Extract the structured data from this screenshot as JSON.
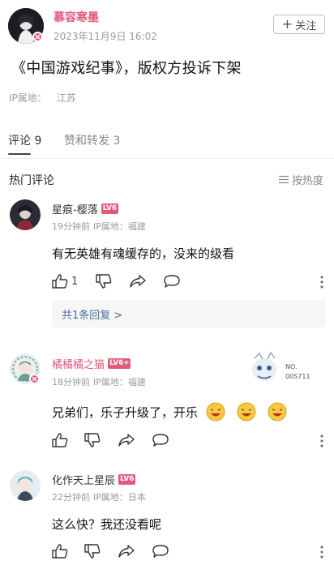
{
  "post": {
    "author": "慕容寒墨",
    "time": "2023年11月9日 16:02",
    "follow_label": "关注",
    "title": "《中国游戏纪事》，版权方投诉下架",
    "ip_label": "IP属地：",
    "ip_value": "江苏"
  },
  "tabs": [
    {
      "label": "评论 9"
    },
    {
      "label": "赞和转发 3"
    }
  ],
  "section": {
    "title": "热门评论",
    "sort_label": "按热度"
  },
  "sticker_text": {
    "line1": "NO.",
    "line2": "00S711"
  },
  "comments": [
    {
      "name": "星痕-樱落",
      "level": "LV6",
      "level_color": "#e05a7a",
      "time": "19分钟前",
      "ip_label": "IP属地：",
      "ip_value": "福建",
      "text": "有无英雄有魂缓存的，没来的级看",
      "likes": "1",
      "replies": "共1条回复 >"
    },
    {
      "name": "橘橘橘之猫",
      "level": "LV6+",
      "level_color": "#e05a7a",
      "time": "18分钟前",
      "ip_label": "IP属地：",
      "ip_value": "福建",
      "text": "兄弟们，乐子升级了，开乐"
    },
    {
      "name": "化作天上星辰",
      "level": "LV6",
      "level_color": "#e05a7a",
      "time": "22分钟前",
      "ip_label": "IP属地：",
      "ip_value": "日本",
      "text": "这么快？我还没看呢"
    }
  ],
  "colors": {
    "accent": "#e05a7a",
    "link": "#4a6f9a",
    "muted": "#9a9a9a"
  }
}
